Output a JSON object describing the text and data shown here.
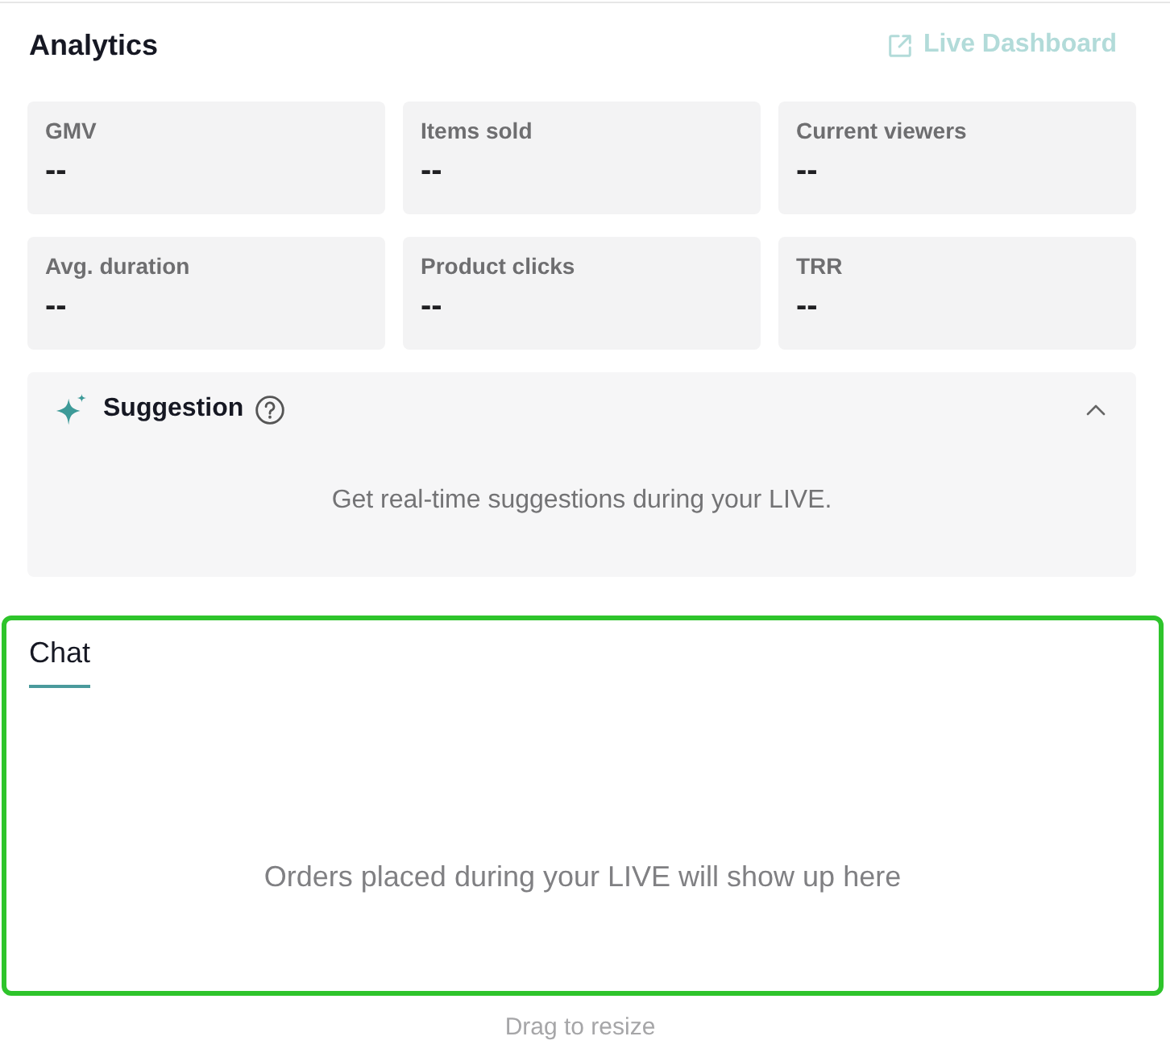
{
  "analytics": {
    "title": "Analytics",
    "live_dashboard": {
      "label": "Live Dashboard",
      "disabled": true
    },
    "metrics": [
      {
        "label": "GMV",
        "value": "--"
      },
      {
        "label": "Items sold",
        "value": "--"
      },
      {
        "label": "Current viewers",
        "value": "--"
      },
      {
        "label": "Avg. duration",
        "value": "--"
      },
      {
        "label": "Product clicks",
        "value": "--"
      },
      {
        "label": "TRR",
        "value": "--"
      }
    ],
    "suggestion": {
      "title": "Suggestion",
      "expanded": true,
      "message": "Get real-time suggestions during your LIVE."
    }
  },
  "chat": {
    "highlighted": true,
    "tabs": [
      {
        "label": "Chat",
        "selected": true
      }
    ],
    "empty_message": "Orders placed during your LIVE will show up here"
  },
  "resize_hint": "Drag to resize"
}
